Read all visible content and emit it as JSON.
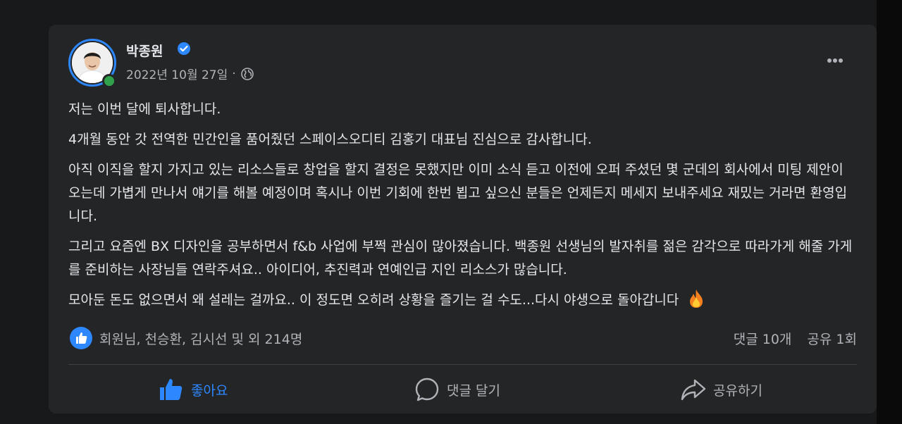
{
  "post": {
    "author": "박종원",
    "date": "2022년 10월 27일",
    "meta_separator": "·",
    "paragraphs": [
      "저는 이번 달에 퇴사합니다.",
      "4개월 동안 갓 전역한 민간인을 품어줬던 스페이스오디티 김홍기 대표님 진심으로 감사합니다.",
      "아직 이직을 할지 가지고 있는 리소스들로 창업을 할지 결정은 못했지만 이미 소식 듣고 이전에 오퍼 주셨던 몇 군데의 회사에서 미팅 제안이 오는데 가볍게 만나서 얘기를 해볼 예정이며 혹시나 이번 기회에 한번 뵙고 싶으신 분들은 언제든지 메세지 보내주세요 재밌는 거라면 환영입니다.",
      "그리고 요즘엔 BX 디자인을 공부하면서 f&b 사업에 부쩍 관심이 많아졌습니다. 백종원 선생님의 발자취를 젊은 감각으로 따라가게 해줄 가게를 준비하는 사장님들 연락주셔요.. 아이디어, 추진력과 연예인급 지인 리소스가 많습니다.",
      "모아둔 돈도 없으면서 왜 설레는 걸까요.. 이 정도면 오히려 상황을 즐기는 걸 수도...다시 야생으로 돌아갑니다"
    ],
    "last_emoji": "fire-icon",
    "reactions_text": "회원님, 천승환, 김시선 및 외 214명",
    "comments_count": "댓글 10개",
    "shares_count": "공유 1회"
  },
  "actions": {
    "like": "좋아요",
    "comment": "댓글 달기",
    "share": "공유하기"
  },
  "colors": {
    "background": "#18191a",
    "card": "#242526",
    "accent": "#2d88ff",
    "text": "#e4e6eb",
    "muted": "#b0b3b8",
    "online": "#31a24c"
  }
}
